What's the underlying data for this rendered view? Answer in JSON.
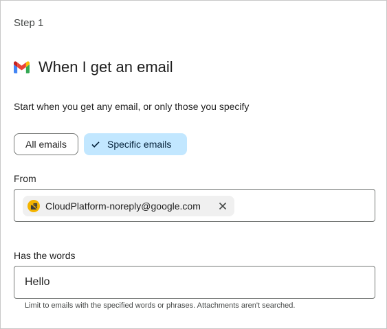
{
  "step": {
    "label": "Step 1"
  },
  "trigger": {
    "icon": "gmail-icon",
    "title": "When I get an email",
    "description": "Start when you get any email, or only those you specify"
  },
  "filter_chips": {
    "all_label": "All emails",
    "specific_label": "Specific emails",
    "selected": "Specific emails"
  },
  "from": {
    "label": "From",
    "chips": [
      {
        "email": "CloudPlatform-noreply@google.com",
        "avatar_color": "#f4b400"
      }
    ]
  },
  "has_words": {
    "label": "Has the words",
    "value": "Hello",
    "hint": "Limit to emails with the specified words or phrases. Attachments aren't searched."
  },
  "colors": {
    "selected_chip_bg": "#c2e7ff",
    "border": "#747775"
  }
}
